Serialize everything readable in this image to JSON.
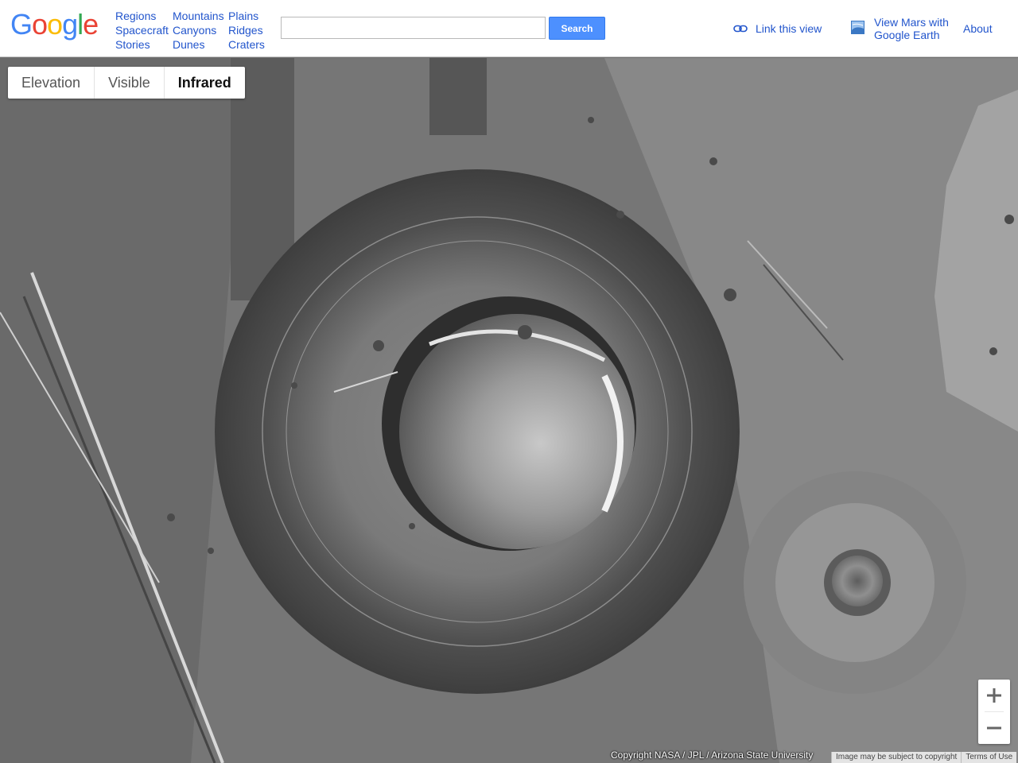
{
  "header": {
    "logo_letters": [
      {
        "char": "G",
        "color": "#4285f4"
      },
      {
        "char": "o",
        "color": "#ea4335"
      },
      {
        "char": "o",
        "color": "#fbbc05"
      },
      {
        "char": "g",
        "color": "#4285f4"
      },
      {
        "char": "l",
        "color": "#34a853"
      },
      {
        "char": "e",
        "color": "#ea4335"
      }
    ],
    "nav_columns": [
      [
        "Regions",
        "Spacecraft",
        "Stories"
      ],
      [
        "Mountains",
        "Canyons",
        "Dunes"
      ],
      [
        "Plains",
        "Ridges",
        "Craters"
      ]
    ],
    "search_value": "",
    "search_button": "Search",
    "link_view": "Link this view",
    "earth_link": "View Mars with Google Earth",
    "about": "About"
  },
  "map": {
    "layer_tabs": [
      "Elevation",
      "Visible",
      "Infrared"
    ],
    "active_tab": "Infrared",
    "zoom_in_icon": "plus-icon",
    "zoom_out_icon": "minus-icon",
    "copyright": "Copyright NASA / JPL / Arizona State University",
    "footer_links": [
      "Image may be subject to copyright",
      "Terms of Use"
    ]
  },
  "colors": {
    "link": "#2255cc",
    "search_button": "#4d90fe"
  }
}
